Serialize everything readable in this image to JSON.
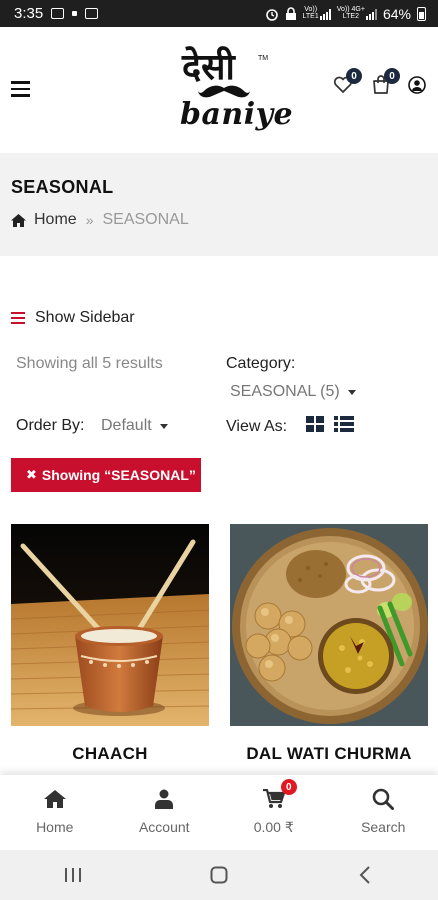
{
  "status_bar": {
    "time": "3:35",
    "battery": "64%",
    "sim1": "VoLTE LTE1",
    "sim2": "VoLTE 4G+ LTE2"
  },
  "header": {
    "logo_hindi": "देसी",
    "logo_tm": "TM",
    "logo_text": "baniye",
    "wishlist_count": "0",
    "cart_count": "0"
  },
  "page": {
    "title": "SEASONAL",
    "breadcrumb": {
      "home": "Home",
      "separator": "»",
      "current": "SEASONAL"
    }
  },
  "toolbar": {
    "show_sidebar": "Show Sidebar",
    "results_text": "Showing all 5 results",
    "category_label": "Category:",
    "category_value": "SEASONAL (5)",
    "order_label": "Order By:",
    "order_value": "Default",
    "view_label": "View As:",
    "filter_chip": "Showing “SEASONAL”"
  },
  "products": [
    {
      "name": "CHAACH"
    },
    {
      "name": "DAL WATI CHURMA"
    }
  ],
  "bottom_nav": {
    "items": [
      {
        "label": "Home",
        "icon": "home-icon"
      },
      {
        "label": "Account",
        "icon": "user-icon"
      },
      {
        "label": "0.00 ₹",
        "icon": "cart-icon",
        "badge": "0"
      },
      {
        "label": "Search",
        "icon": "search-icon"
      }
    ]
  },
  "colors": {
    "accent": "#c8102e",
    "badge_dark": "#1c2a3f",
    "badge_red": "#e01a22"
  }
}
